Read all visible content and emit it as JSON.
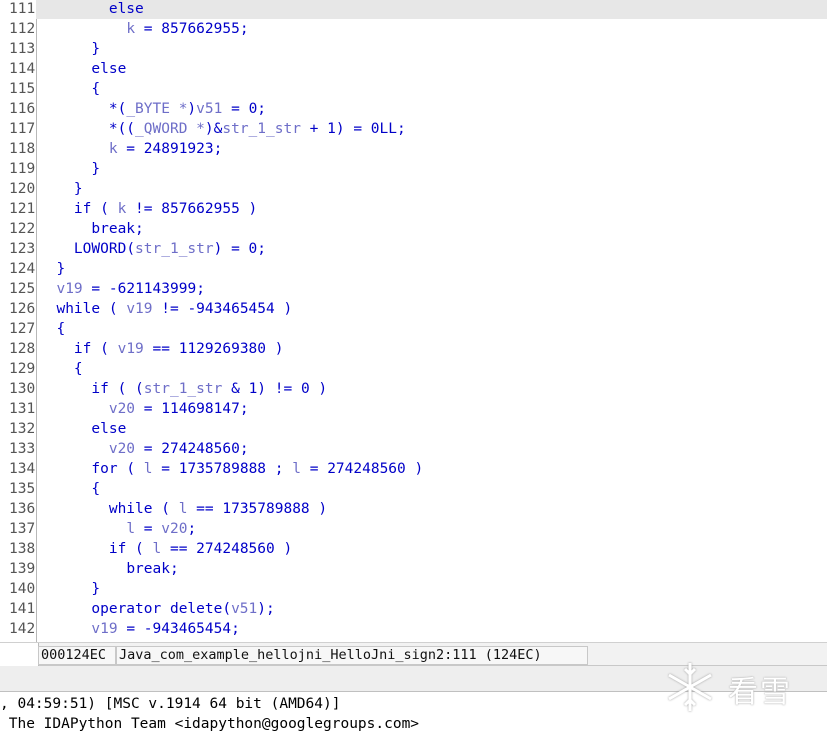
{
  "code_lines": [
    {
      "num": "111",
      "tokens": [
        [
          "s",
          "        "
        ],
        [
          "k",
          "else"
        ]
      ],
      "current": true
    },
    {
      "num": "112",
      "tokens": [
        [
          "s",
          "          "
        ],
        [
          "v",
          "k"
        ],
        [
          "p",
          " = "
        ],
        [
          "n",
          "857662955"
        ],
        [
          "p",
          ";"
        ]
      ]
    },
    {
      "num": "113",
      "tokens": [
        [
          "s",
          "      "
        ],
        [
          "p",
          "}"
        ]
      ]
    },
    {
      "num": "114",
      "tokens": [
        [
          "s",
          "      "
        ],
        [
          "k",
          "else"
        ]
      ]
    },
    {
      "num": "115",
      "tokens": [
        [
          "s",
          "      "
        ],
        [
          "p",
          "{"
        ]
      ]
    },
    {
      "num": "116",
      "tokens": [
        [
          "s",
          "        "
        ],
        [
          "p",
          "*("
        ],
        [
          "t",
          "_BYTE *"
        ],
        [
          "p",
          ")"
        ],
        [
          "v",
          "v51"
        ],
        [
          "p",
          " = "
        ],
        [
          "n",
          "0"
        ],
        [
          "p",
          ";"
        ]
      ]
    },
    {
      "num": "117",
      "tokens": [
        [
          "s",
          "        "
        ],
        [
          "p",
          "*(("
        ],
        [
          "t",
          "_QWORD *"
        ],
        [
          "p",
          ")&"
        ],
        [
          "v",
          "str_1_str"
        ],
        [
          "p",
          " + "
        ],
        [
          "n",
          "1"
        ],
        [
          "p",
          ") = "
        ],
        [
          "n",
          "0LL"
        ],
        [
          "p",
          ";"
        ]
      ]
    },
    {
      "num": "118",
      "tokens": [
        [
          "s",
          "        "
        ],
        [
          "v",
          "k"
        ],
        [
          "p",
          " = "
        ],
        [
          "n",
          "24891923"
        ],
        [
          "p",
          ";"
        ]
      ]
    },
    {
      "num": "119",
      "tokens": [
        [
          "s",
          "      "
        ],
        [
          "p",
          "}"
        ]
      ]
    },
    {
      "num": "120",
      "tokens": [
        [
          "s",
          "    "
        ],
        [
          "p",
          "}"
        ]
      ]
    },
    {
      "num": "121",
      "tokens": [
        [
          "s",
          "    "
        ],
        [
          "k",
          "if"
        ],
        [
          "p",
          " ( "
        ],
        [
          "v",
          "k"
        ],
        [
          "p",
          " != "
        ],
        [
          "n",
          "857662955"
        ],
        [
          "p",
          " )"
        ]
      ]
    },
    {
      "num": "122",
      "tokens": [
        [
          "s",
          "      "
        ],
        [
          "k",
          "break"
        ],
        [
          "p",
          ";"
        ]
      ]
    },
    {
      "num": "123",
      "tokens": [
        [
          "s",
          "    "
        ],
        [
          "k",
          "LOWORD"
        ],
        [
          "p",
          "("
        ],
        [
          "v",
          "str_1_str"
        ],
        [
          "p",
          ") = "
        ],
        [
          "n",
          "0"
        ],
        [
          "p",
          ";"
        ]
      ]
    },
    {
      "num": "124",
      "tokens": [
        [
          "s",
          "  "
        ],
        [
          "p",
          "}"
        ]
      ]
    },
    {
      "num": "125",
      "tokens": [
        [
          "s",
          "  "
        ],
        [
          "v",
          "v19"
        ],
        [
          "p",
          " = "
        ],
        [
          "n",
          "-621143999"
        ],
        [
          "p",
          ";"
        ]
      ]
    },
    {
      "num": "126",
      "tokens": [
        [
          "s",
          "  "
        ],
        [
          "k",
          "while"
        ],
        [
          "p",
          " ( "
        ],
        [
          "v",
          "v19"
        ],
        [
          "p",
          " != "
        ],
        [
          "n",
          "-943465454"
        ],
        [
          "p",
          " )"
        ]
      ]
    },
    {
      "num": "127",
      "tokens": [
        [
          "s",
          "  "
        ],
        [
          "p",
          "{"
        ]
      ]
    },
    {
      "num": "128",
      "tokens": [
        [
          "s",
          "    "
        ],
        [
          "k",
          "if"
        ],
        [
          "p",
          " ( "
        ],
        [
          "v",
          "v19"
        ],
        [
          "p",
          " == "
        ],
        [
          "n",
          "1129269380"
        ],
        [
          "p",
          " )"
        ]
      ]
    },
    {
      "num": "129",
      "tokens": [
        [
          "s",
          "    "
        ],
        [
          "p",
          "{"
        ]
      ]
    },
    {
      "num": "130",
      "tokens": [
        [
          "s",
          "      "
        ],
        [
          "k",
          "if"
        ],
        [
          "p",
          " ( ("
        ],
        [
          "v",
          "str_1_str"
        ],
        [
          "p",
          " & "
        ],
        [
          "n",
          "1"
        ],
        [
          "p",
          ") != "
        ],
        [
          "n",
          "0"
        ],
        [
          "p",
          " )"
        ]
      ]
    },
    {
      "num": "131",
      "tokens": [
        [
          "s",
          "        "
        ],
        [
          "v",
          "v20"
        ],
        [
          "p",
          " = "
        ],
        [
          "n",
          "114698147"
        ],
        [
          "p",
          ";"
        ]
      ]
    },
    {
      "num": "132",
      "tokens": [
        [
          "s",
          "      "
        ],
        [
          "k",
          "else"
        ]
      ]
    },
    {
      "num": "133",
      "tokens": [
        [
          "s",
          "        "
        ],
        [
          "v",
          "v20"
        ],
        [
          "p",
          " = "
        ],
        [
          "n",
          "274248560"
        ],
        [
          "p",
          ";"
        ]
      ]
    },
    {
      "num": "134",
      "tokens": [
        [
          "s",
          "      "
        ],
        [
          "k",
          "for"
        ],
        [
          "p",
          " ( "
        ],
        [
          "v",
          "l"
        ],
        [
          "p",
          " = "
        ],
        [
          "n",
          "1735789888"
        ],
        [
          "p",
          " ; "
        ],
        [
          "v",
          "l"
        ],
        [
          "p",
          " = "
        ],
        [
          "n",
          "274248560"
        ],
        [
          "p",
          " )"
        ]
      ]
    },
    {
      "num": "135",
      "tokens": [
        [
          "s",
          "      "
        ],
        [
          "p",
          "{"
        ]
      ]
    },
    {
      "num": "136",
      "tokens": [
        [
          "s",
          "        "
        ],
        [
          "k",
          "while"
        ],
        [
          "p",
          " ( "
        ],
        [
          "v",
          "l"
        ],
        [
          "p",
          " == "
        ],
        [
          "n",
          "1735789888"
        ],
        [
          "p",
          " )"
        ]
      ]
    },
    {
      "num": "137",
      "tokens": [
        [
          "s",
          "          "
        ],
        [
          "v",
          "l"
        ],
        [
          "p",
          " = "
        ],
        [
          "v",
          "v20"
        ],
        [
          "p",
          ";"
        ]
      ]
    },
    {
      "num": "138",
      "tokens": [
        [
          "s",
          "        "
        ],
        [
          "k",
          "if"
        ],
        [
          "p",
          " ( "
        ],
        [
          "v",
          "l"
        ],
        [
          "p",
          " == "
        ],
        [
          "n",
          "274248560"
        ],
        [
          "p",
          " )"
        ]
      ]
    },
    {
      "num": "139",
      "tokens": [
        [
          "s",
          "          "
        ],
        [
          "k",
          "break"
        ],
        [
          "p",
          ";"
        ]
      ]
    },
    {
      "num": "140",
      "tokens": [
        [
          "s",
          "      "
        ],
        [
          "p",
          "}"
        ]
      ]
    },
    {
      "num": "141",
      "tokens": [
        [
          "s",
          "      "
        ],
        [
          "k",
          "operator delete"
        ],
        [
          "p",
          "("
        ],
        [
          "v",
          "v51"
        ],
        [
          "p",
          ");"
        ]
      ]
    },
    {
      "num": "142",
      "tokens": [
        [
          "s",
          "      "
        ],
        [
          "v",
          "v19"
        ],
        [
          "p",
          " = "
        ],
        [
          "n",
          "-943465454"
        ],
        [
          "p",
          ";"
        ]
      ]
    }
  ],
  "status": {
    "address": "000124EC",
    "location": "Java_com_example_hellojni_HelloJni_sign2:111 (124EC)"
  },
  "output_lines": [
    ", 04:59:51) [MSC v.1914 64 bit (AMD64)]",
    " The IDAPython Team <idapython@googlegroups.com>"
  ],
  "watermark": {
    "icon": "snowflake-icon",
    "text": "看雪"
  },
  "colors": {
    "keyword": "#0000c8",
    "variable": "#6e6ec8",
    "current_line": "#e7e7e7"
  }
}
